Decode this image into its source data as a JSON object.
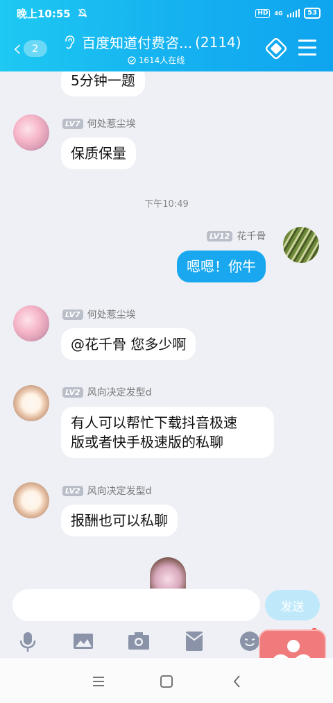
{
  "status_bar": {
    "time": "晚上10:55",
    "hd_label": "HD",
    "network": "4G",
    "battery": "53"
  },
  "header": {
    "back_count": "2",
    "title": "百度知道付费咨...",
    "member_count": "(2114)",
    "online": "1614人在线"
  },
  "messages": [
    {
      "text": "5分钟一题"
    },
    {
      "level": "LV7",
      "sender": "何处惹尘埃",
      "text": "保质保量"
    },
    {
      "timestamp": "下午10:49"
    },
    {
      "level": "LV12",
      "sender": "花千骨",
      "text": "嗯嗯！你牛"
    },
    {
      "level": "LV7",
      "sender": "何处惹尘埃",
      "text": "@花千骨 您多少啊"
    },
    {
      "level": "LV2",
      "sender": "风向决定发型d",
      "text_line1": "有人可以帮忙下载抖音极速",
      "text_line2": "版或者快手极速版的私聊"
    },
    {
      "level": "LV2",
      "sender": "风向决定发型d",
      "text": "报酬也可以私聊"
    }
  ],
  "composer": {
    "input_value": "",
    "send_label": "发送"
  },
  "toolbar_icons": [
    "mic-icon",
    "image-icon",
    "camera-icon",
    "red-packet-icon",
    "emoji-icon"
  ],
  "colors": {
    "header_start": "#1ec9f2",
    "header_end": "#0fa4ef",
    "own_bubble": "#19a8ef",
    "send_button": "#bfe9fb"
  }
}
